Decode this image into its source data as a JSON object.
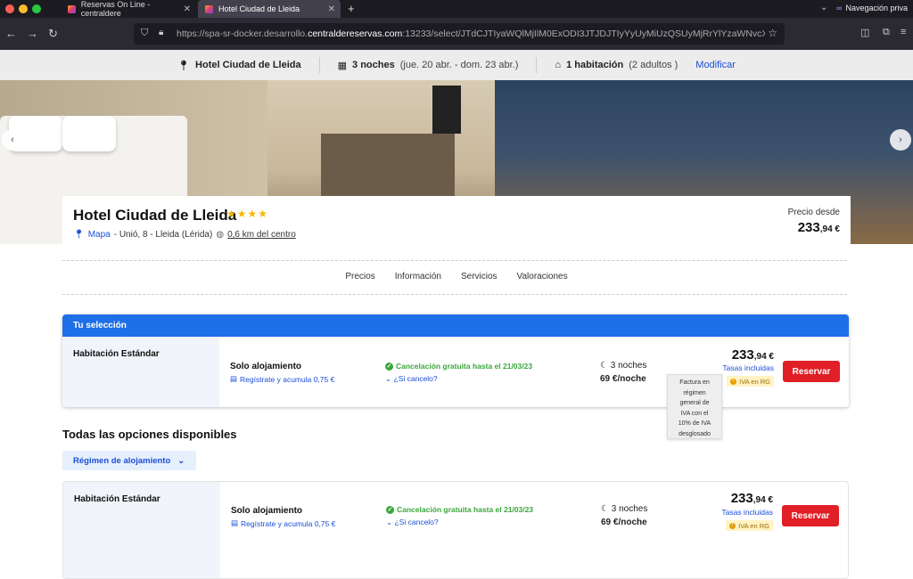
{
  "browser": {
    "tabs": [
      {
        "label": "Reservas On Line - centraldere"
      },
      {
        "label": "Hotel Ciudad de Lleida"
      }
    ],
    "private_label": "Navegación priva",
    "url_prefix": "https://spa-sr-docker.desarrollo.",
    "url_domain": "centraldereservas.com",
    "url_rest": ":13233/select/JTdCJTIyaWQlMjIlM0ExODI3JTJDJTIyYyUyMiUzQSUyMjRrYlYzaWNvcXRHZjI"
  },
  "summary": {
    "hotel": "Hotel Ciudad de Lleida",
    "nights": "3 noches",
    "dates": "(jue. 20 abr. - dom. 23 abr.)",
    "rooms": "1 habitación",
    "guests": "(2 adultos )",
    "modify": "Modificar"
  },
  "hotel": {
    "name": "Hotel Ciudad de Lleida",
    "stars": "★★★★",
    "map": "Mapa",
    "address": "- Unió, 8 - Lleida (Lérida)",
    "distance": "0,6 km del centro",
    "price_from_label": "Precio desde",
    "price_int": "233",
    "price_dec": ",94 €"
  },
  "nav_tabs": [
    "Precios",
    "Información",
    "Servicios",
    "Valoraciones"
  ],
  "selection": {
    "header": "Tu selección",
    "room": "Habitación Estándar",
    "regime": "Solo alojamiento",
    "points": "Regístrate y acumula 0,75 €",
    "cancellation": "Cancelación gratuita hasta el 21/03/23",
    "if_cancel": "¿Si cancelo?",
    "nights": "3 noches",
    "per_night": "69 €/noche",
    "price_int": "233",
    "price_dec": ",94 €",
    "taxes": "Tasas incluidas",
    "iva": "IVA en RG",
    "reserve": "Reservar"
  },
  "tooltip": {
    "lines": [
      "Factura en",
      "régimen",
      "general de",
      "IVA con el",
      "10% de IVA",
      "desglosado"
    ]
  },
  "all_options": {
    "title": "Todas las opciones disponibles",
    "filter": "Régimen de alojamiento",
    "room": "Habitación Estándar",
    "regime": "Solo alojamiento",
    "points": "Regístrate y acumula 0,75 €",
    "cancellation": "Cancelación gratuita hasta el 21/03/23",
    "if_cancel": "¿Si cancelo?",
    "nights": "3 noches",
    "per_night": "69 €/noche",
    "price_int": "233",
    "price_dec": ",94 €",
    "taxes": "Tasas incluidas",
    "iva": "IVA en RG",
    "reserve": "Reservar"
  },
  "colors": {
    "accent_blue": "#1f6fe8",
    "reserve_red": "#e01f26",
    "green": "#3aa63a",
    "star": "#f5b800"
  }
}
